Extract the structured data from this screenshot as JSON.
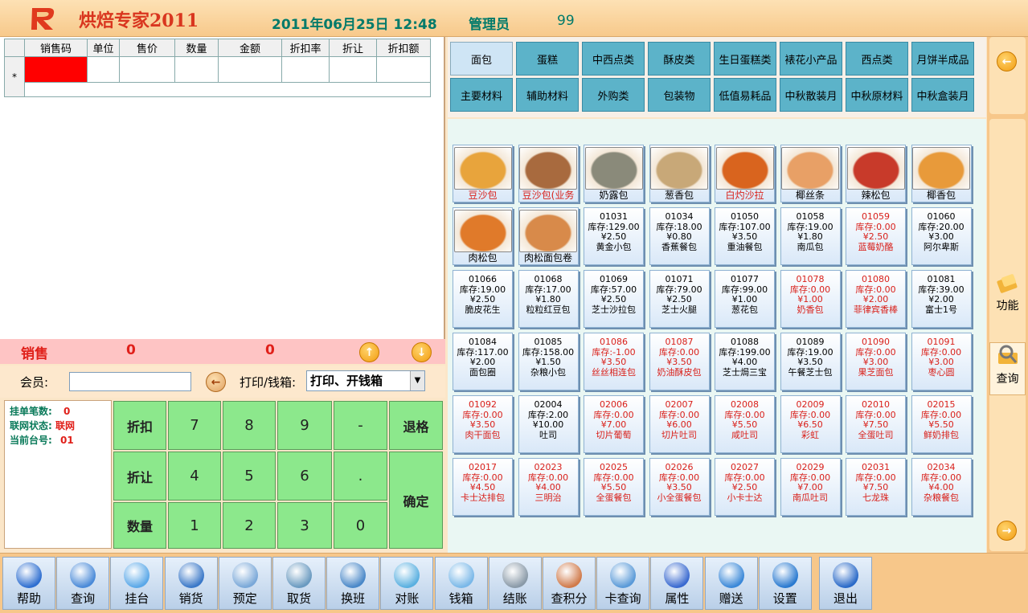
{
  "header": {
    "app_title": "烘焙专家2011",
    "datetime": "2011年06月25日  12:48",
    "role": "管理员",
    "user_no": "99"
  },
  "sales_table": {
    "columns": [
      "销售码",
      "单位",
      "售价",
      "数量",
      "金额",
      "折扣率",
      "折让",
      "折扣额"
    ],
    "new_row_marker": "*"
  },
  "sales_bar": {
    "label": "销售",
    "qty": "0",
    "amount": "0"
  },
  "member": {
    "label": "会员:",
    "value": "",
    "print_label": "打印/钱箱:",
    "print_value": "打印、开钱箱"
  },
  "status": {
    "pending_label": "挂单笔数:",
    "pending_value": "0",
    "network_label": "联网状态:",
    "network_value": "联网",
    "station_label": "当前台号:",
    "station_value": "01"
  },
  "keypad": {
    "discount": "折扣",
    "allowance": "折让",
    "quantity": "数量",
    "k7": "7",
    "k8": "8",
    "k9": "9",
    "minus": "-",
    "k4": "4",
    "k5": "5",
    "k6": "6",
    "dot": ".",
    "k1": "1",
    "k2": "2",
    "k3": "3",
    "k0": "0",
    "backspace": "退格",
    "confirm": "确定"
  },
  "categories": [
    "面包",
    "蛋糕",
    "中西点类",
    "酥皮类",
    "生日蛋糕类",
    "裱花小产品",
    "西点类",
    "月饼半成品",
    "主要材料",
    "辅助材料",
    "外购类",
    "包装物",
    "低值易耗品",
    "中秋散装月",
    "中秋原材料",
    "中秋盒装月"
  ],
  "side": {
    "function_label": "功能",
    "query_label": "查询"
  },
  "products_picture": [
    {
      "name": "豆沙包",
      "red": true,
      "color": "#e8a43c"
    },
    {
      "name": "豆沙包(业务",
      "red": true,
      "color": "#a86a3e"
    },
    {
      "name": "奶露包",
      "red": false,
      "color": "#8a8a7a"
    },
    {
      "name": "葱香包",
      "red": false,
      "color": "#c8a878"
    },
    {
      "name": "白灼沙拉",
      "red": true,
      "color": "#d9641e"
    },
    {
      "name": "椰丝条",
      "red": false,
      "color": "#e8a066"
    },
    {
      "name": "辣松包",
      "red": false,
      "color": "#c83a2a"
    },
    {
      "name": "椰香包",
      "red": false,
      "color": "#e89a3a"
    },
    {
      "name": "肉松包",
      "red": false,
      "color": "#e07a2a"
    },
    {
      "name": "肉松面包卷",
      "red": false,
      "color": "#d88a4a"
    }
  ],
  "products": [
    {
      "code": "01031",
      "stock": "库存:129.00",
      "price": "¥2.50",
      "name": "黄金小包",
      "red": false
    },
    {
      "code": "01034",
      "stock": "库存:18.00",
      "price": "¥0.80",
      "name": "香蕉餐包",
      "red": false
    },
    {
      "code": "01050",
      "stock": "库存:107.00",
      "price": "¥3.50",
      "name": "重油餐包",
      "red": false
    },
    {
      "code": "01058",
      "stock": "库存:19.00",
      "price": "¥1.80",
      "name": "南瓜包",
      "red": false
    },
    {
      "code": "01059",
      "stock": "库存:0.00",
      "price": "¥2.50",
      "name": "蓝莓奶酪",
      "red": true
    },
    {
      "code": "01060",
      "stock": "库存:20.00",
      "price": "¥3.00",
      "name": "阿尔卑斯",
      "red": false
    },
    {
      "code": "01066",
      "stock": "库存:19.00",
      "price": "¥2.50",
      "name": "脆皮花生",
      "red": false
    },
    {
      "code": "01068",
      "stock": "库存:17.00",
      "price": "¥1.80",
      "name": "粒粒红豆包",
      "red": false
    },
    {
      "code": "01069",
      "stock": "库存:57.00",
      "price": "¥2.50",
      "name": "芝士沙拉包",
      "red": false
    },
    {
      "code": "01071",
      "stock": "库存:79.00",
      "price": "¥2.50",
      "name": "芝士火腿",
      "red": false
    },
    {
      "code": "01077",
      "stock": "库存:99.00",
      "price": "¥1.00",
      "name": "葱花包",
      "red": false
    },
    {
      "code": "01078",
      "stock": "库存:0.00",
      "price": "¥1.00",
      "name": "奶香包",
      "red": true
    },
    {
      "code": "01080",
      "stock": "库存:0.00",
      "price": "¥2.00",
      "name": "菲律宾香棒",
      "red": true
    },
    {
      "code": "01081",
      "stock": "库存:39.00",
      "price": "¥2.00",
      "name": "富士1号",
      "red": false
    },
    {
      "code": "01084",
      "stock": "库存:117.00",
      "price": "¥2.00",
      "name": "面包圈",
      "red": false
    },
    {
      "code": "01085",
      "stock": "库存:158.00",
      "price": "¥1.50",
      "name": "杂粮小包",
      "red": false
    },
    {
      "code": "01086",
      "stock": "库存:-1.00",
      "price": "¥3.50",
      "name": "丝丝相连包",
      "red": true
    },
    {
      "code": "01087",
      "stock": "库存:0.00",
      "price": "¥3.50",
      "name": "奶油酥皮包",
      "red": true
    },
    {
      "code": "01088",
      "stock": "库存:199.00",
      "price": "¥4.00",
      "name": "芝士焗三宝",
      "red": false
    },
    {
      "code": "01089",
      "stock": "库存:19.00",
      "price": "¥3.50",
      "name": "午餐芝士包",
      "red": false
    },
    {
      "code": "01090",
      "stock": "库存:0.00",
      "price": "¥3.00",
      "name": "果芝面包",
      "red": true
    },
    {
      "code": "01091",
      "stock": "库存:0.00",
      "price": "¥3.00",
      "name": "枣心圆",
      "red": true
    },
    {
      "code": "01092",
      "stock": "库存:0.00",
      "price": "¥3.50",
      "name": "肉干面包",
      "red": true
    },
    {
      "code": "02004",
      "stock": "库存:2.00",
      "price": "¥10.00",
      "name": "吐司",
      "red": false
    },
    {
      "code": "02006",
      "stock": "库存:0.00",
      "price": "¥7.00",
      "name": "切片葡萄",
      "red": true
    },
    {
      "code": "02007",
      "stock": "库存:0.00",
      "price": "¥6.00",
      "name": "切片吐司",
      "red": true
    },
    {
      "code": "02008",
      "stock": "库存:0.00",
      "price": "¥5.50",
      "name": "咸吐司",
      "red": true
    },
    {
      "code": "02009",
      "stock": "库存:0.00",
      "price": "¥6.50",
      "name": "彩虹",
      "red": true
    },
    {
      "code": "02010",
      "stock": "库存:0.00",
      "price": "¥7.50",
      "name": "全蛋吐司",
      "red": true
    },
    {
      "code": "02015",
      "stock": "库存:0.00",
      "price": "¥5.50",
      "name": "鲜奶排包",
      "red": true
    },
    {
      "code": "02017",
      "stock": "库存:0.00",
      "price": "¥4.50",
      "name": "卡士达排包",
      "red": true
    },
    {
      "code": "02023",
      "stock": "库存:0.00",
      "price": "¥4.00",
      "name": "三明治",
      "red": true
    },
    {
      "code": "02025",
      "stock": "库存:0.00",
      "price": "¥5.50",
      "name": "全蛋餐包",
      "red": true
    },
    {
      "code": "02026",
      "stock": "库存:0.00",
      "price": "¥3.50",
      "name": "小全蛋餐包",
      "red": true
    },
    {
      "code": "02027",
      "stock": "库存:0.00",
      "price": "¥2.50",
      "name": "小卡士达",
      "red": true
    },
    {
      "code": "02029",
      "stock": "库存:0.00",
      "price": "¥7.00",
      "name": "南瓜吐司",
      "red": true
    },
    {
      "code": "02031",
      "stock": "库存:0.00",
      "price": "¥7.50",
      "name": "七龙珠",
      "red": true
    },
    {
      "code": "02034",
      "stock": "库存:0.00",
      "price": "¥4.00",
      "name": "杂粮餐包",
      "red": true
    }
  ],
  "toolbar": [
    {
      "label": "帮助",
      "icon": "help-icon",
      "color": "#2f6fd0"
    },
    {
      "label": "查询",
      "icon": "magnifier-icon",
      "color": "#4a8ad8"
    },
    {
      "label": "挂台",
      "icon": "bubble-icon",
      "color": "#5aa8e8"
    },
    {
      "label": "销货",
      "icon": "cross-icon",
      "color": "#3a78c8"
    },
    {
      "label": "预定",
      "icon": "phone-icon",
      "color": "#7aa8d8"
    },
    {
      "label": "取货",
      "icon": "cart-icon",
      "color": "#6a9ac0"
    },
    {
      "label": "换班",
      "icon": "lock-icon",
      "color": "#4a88c8"
    },
    {
      "label": "对账",
      "icon": "calculator-icon",
      "color": "#5ab0e0"
    },
    {
      "label": "钱箱",
      "icon": "bulb-icon",
      "color": "#7ab8e8"
    },
    {
      "label": "结账",
      "icon": "receipt-icon",
      "color": "#8a9aa8"
    },
    {
      "label": "查积分",
      "icon": "person-icon",
      "color": "#d07a4a"
    },
    {
      "label": "卡查询",
      "icon": "card-icon",
      "color": "#5a9ad8"
    },
    {
      "label": "属性",
      "icon": "snowflake-icon",
      "color": "#3a6ad0"
    },
    {
      "label": "赠送",
      "icon": "info-icon",
      "color": "#3a88d8"
    },
    {
      "label": "设置",
      "icon": "pin-icon",
      "color": "#2a7ad0"
    },
    {
      "label": "退出",
      "icon": "power-icon",
      "color": "#2a6ac8"
    }
  ]
}
